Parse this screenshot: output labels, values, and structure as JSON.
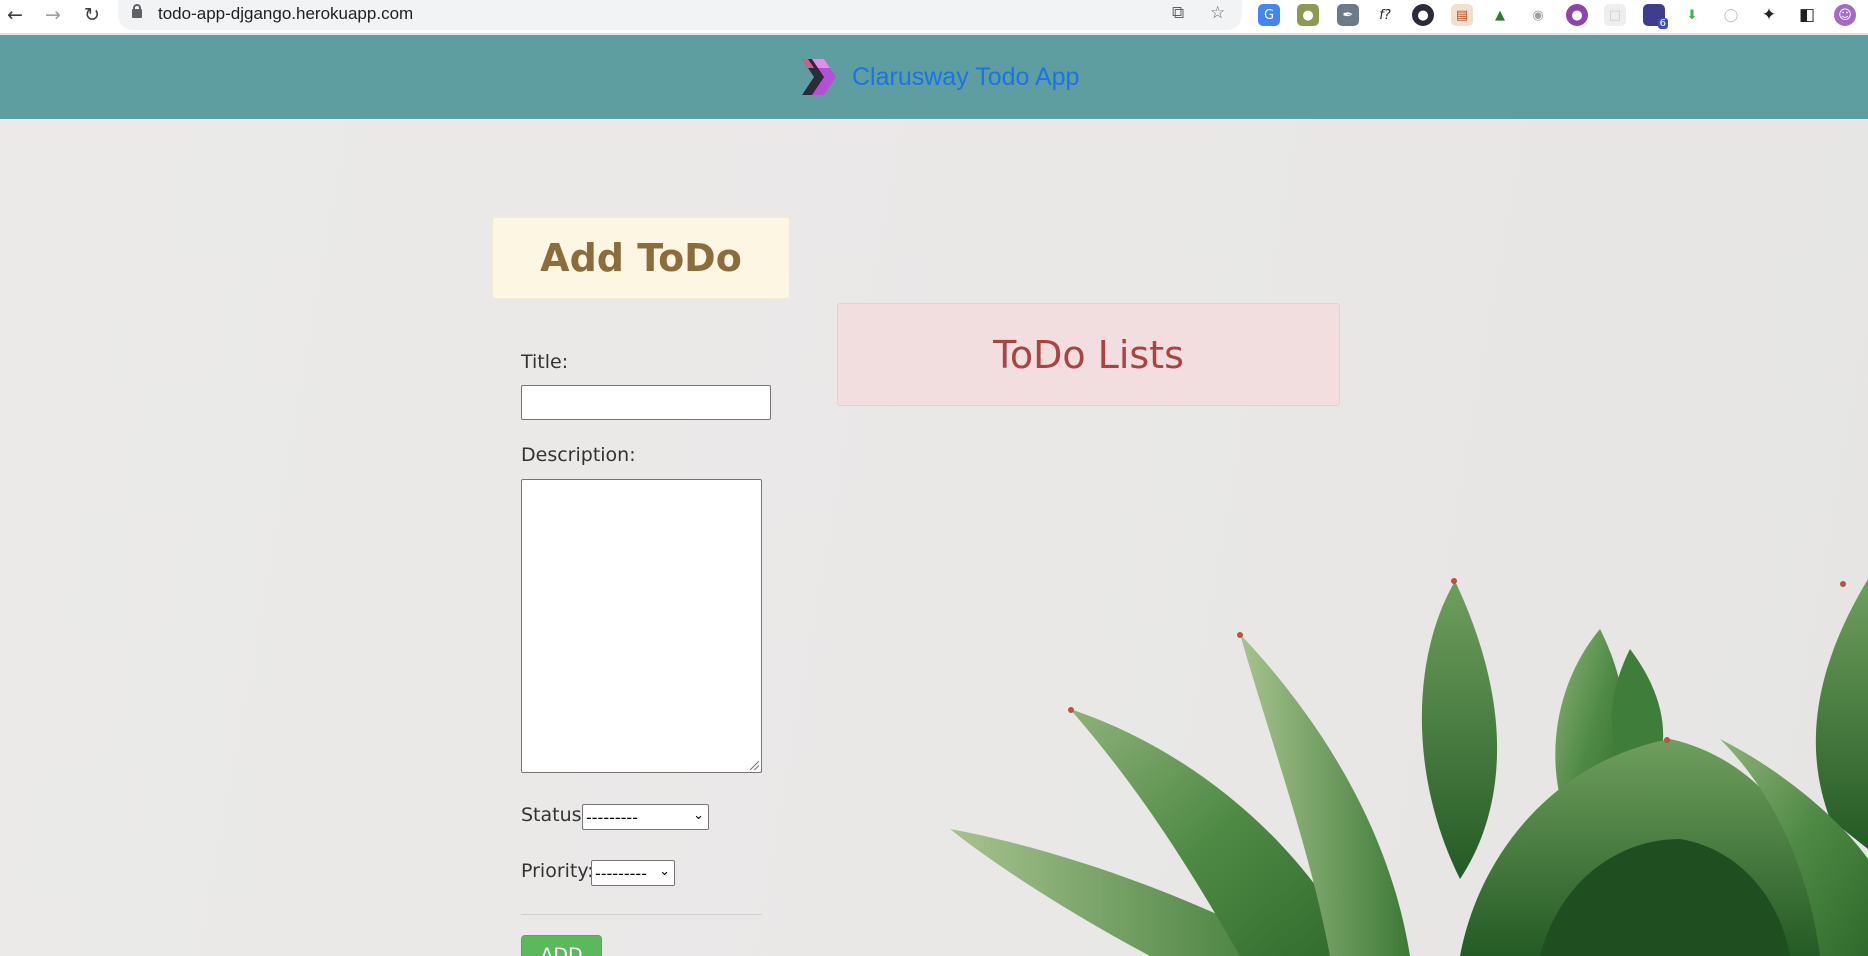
{
  "browser": {
    "url": "todo-app-djgango.herokuapp.com",
    "extension_badge": "6"
  },
  "navbar": {
    "brand_text": "Clarusway Todo App"
  },
  "add_section": {
    "heading": "Add ToDo",
    "title_label": "Title:",
    "title_value": "",
    "description_label": "Description:",
    "description_value": "",
    "status_label": "Status:",
    "status_selected": "---------",
    "priority_label": "Priority:",
    "priority_selected": "---------",
    "add_button": "ADD"
  },
  "list_section": {
    "heading": "ToDo Lists"
  },
  "colors": {
    "navbar": "#5f9ea0",
    "brand_link": "#1a73e8",
    "add_header_bg": "#fdf6e3",
    "add_header_text": "#8a6d3b",
    "list_header_bg": "#f2dede",
    "list_header_text": "#a94442",
    "add_button": "#5cb85c"
  }
}
